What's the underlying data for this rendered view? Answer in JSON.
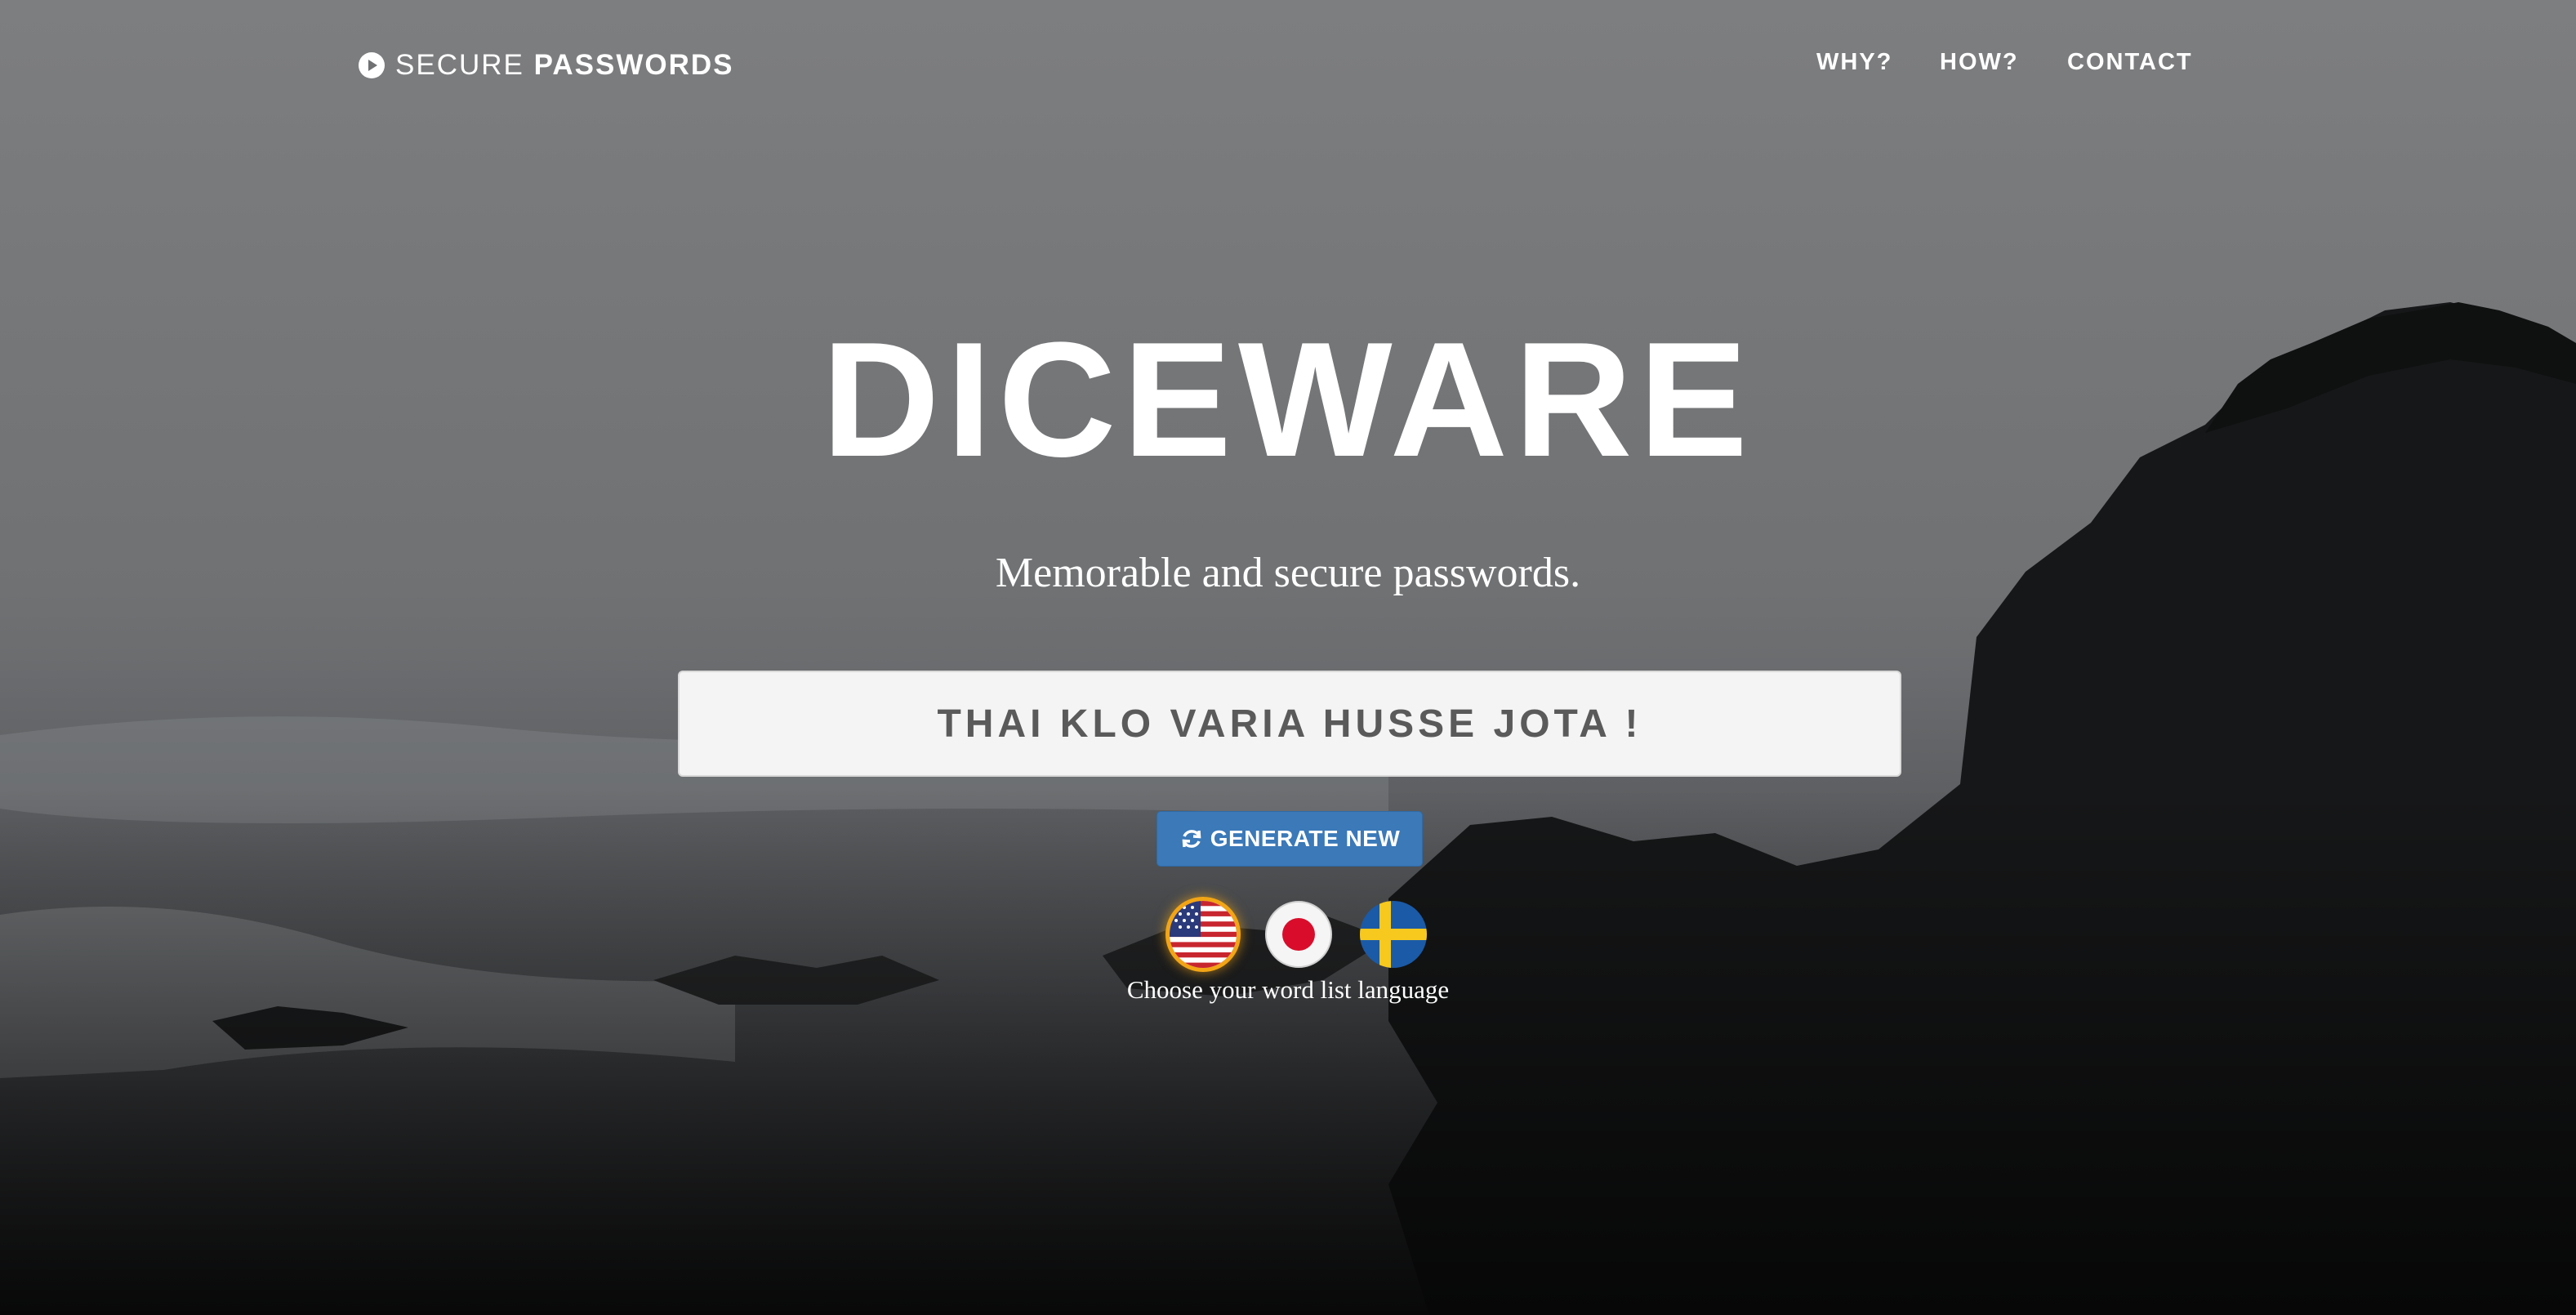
{
  "nav": {
    "brand_light": "SECURE",
    "brand_bold": "PASSWORDS",
    "links": [
      "WHY?",
      "HOW?",
      "CONTACT"
    ]
  },
  "hero": {
    "title": "DICEWARE",
    "tagline": "Memorable and secure passwords.",
    "password": "THAI KLO VARIA HUSSE JOTA !",
    "generate_label": "GENERATE NEW",
    "language_label": "Choose your word list language",
    "languages": [
      {
        "name": "us-flag-icon",
        "selected": true
      },
      {
        "name": "japan-flag-icon",
        "selected": false
      },
      {
        "name": "sweden-flag-icon",
        "selected": false
      }
    ]
  },
  "colors": {
    "button": "#3b79b8",
    "flag_selected_ring": "#f2a515",
    "password_box": "#f4f4f4"
  }
}
